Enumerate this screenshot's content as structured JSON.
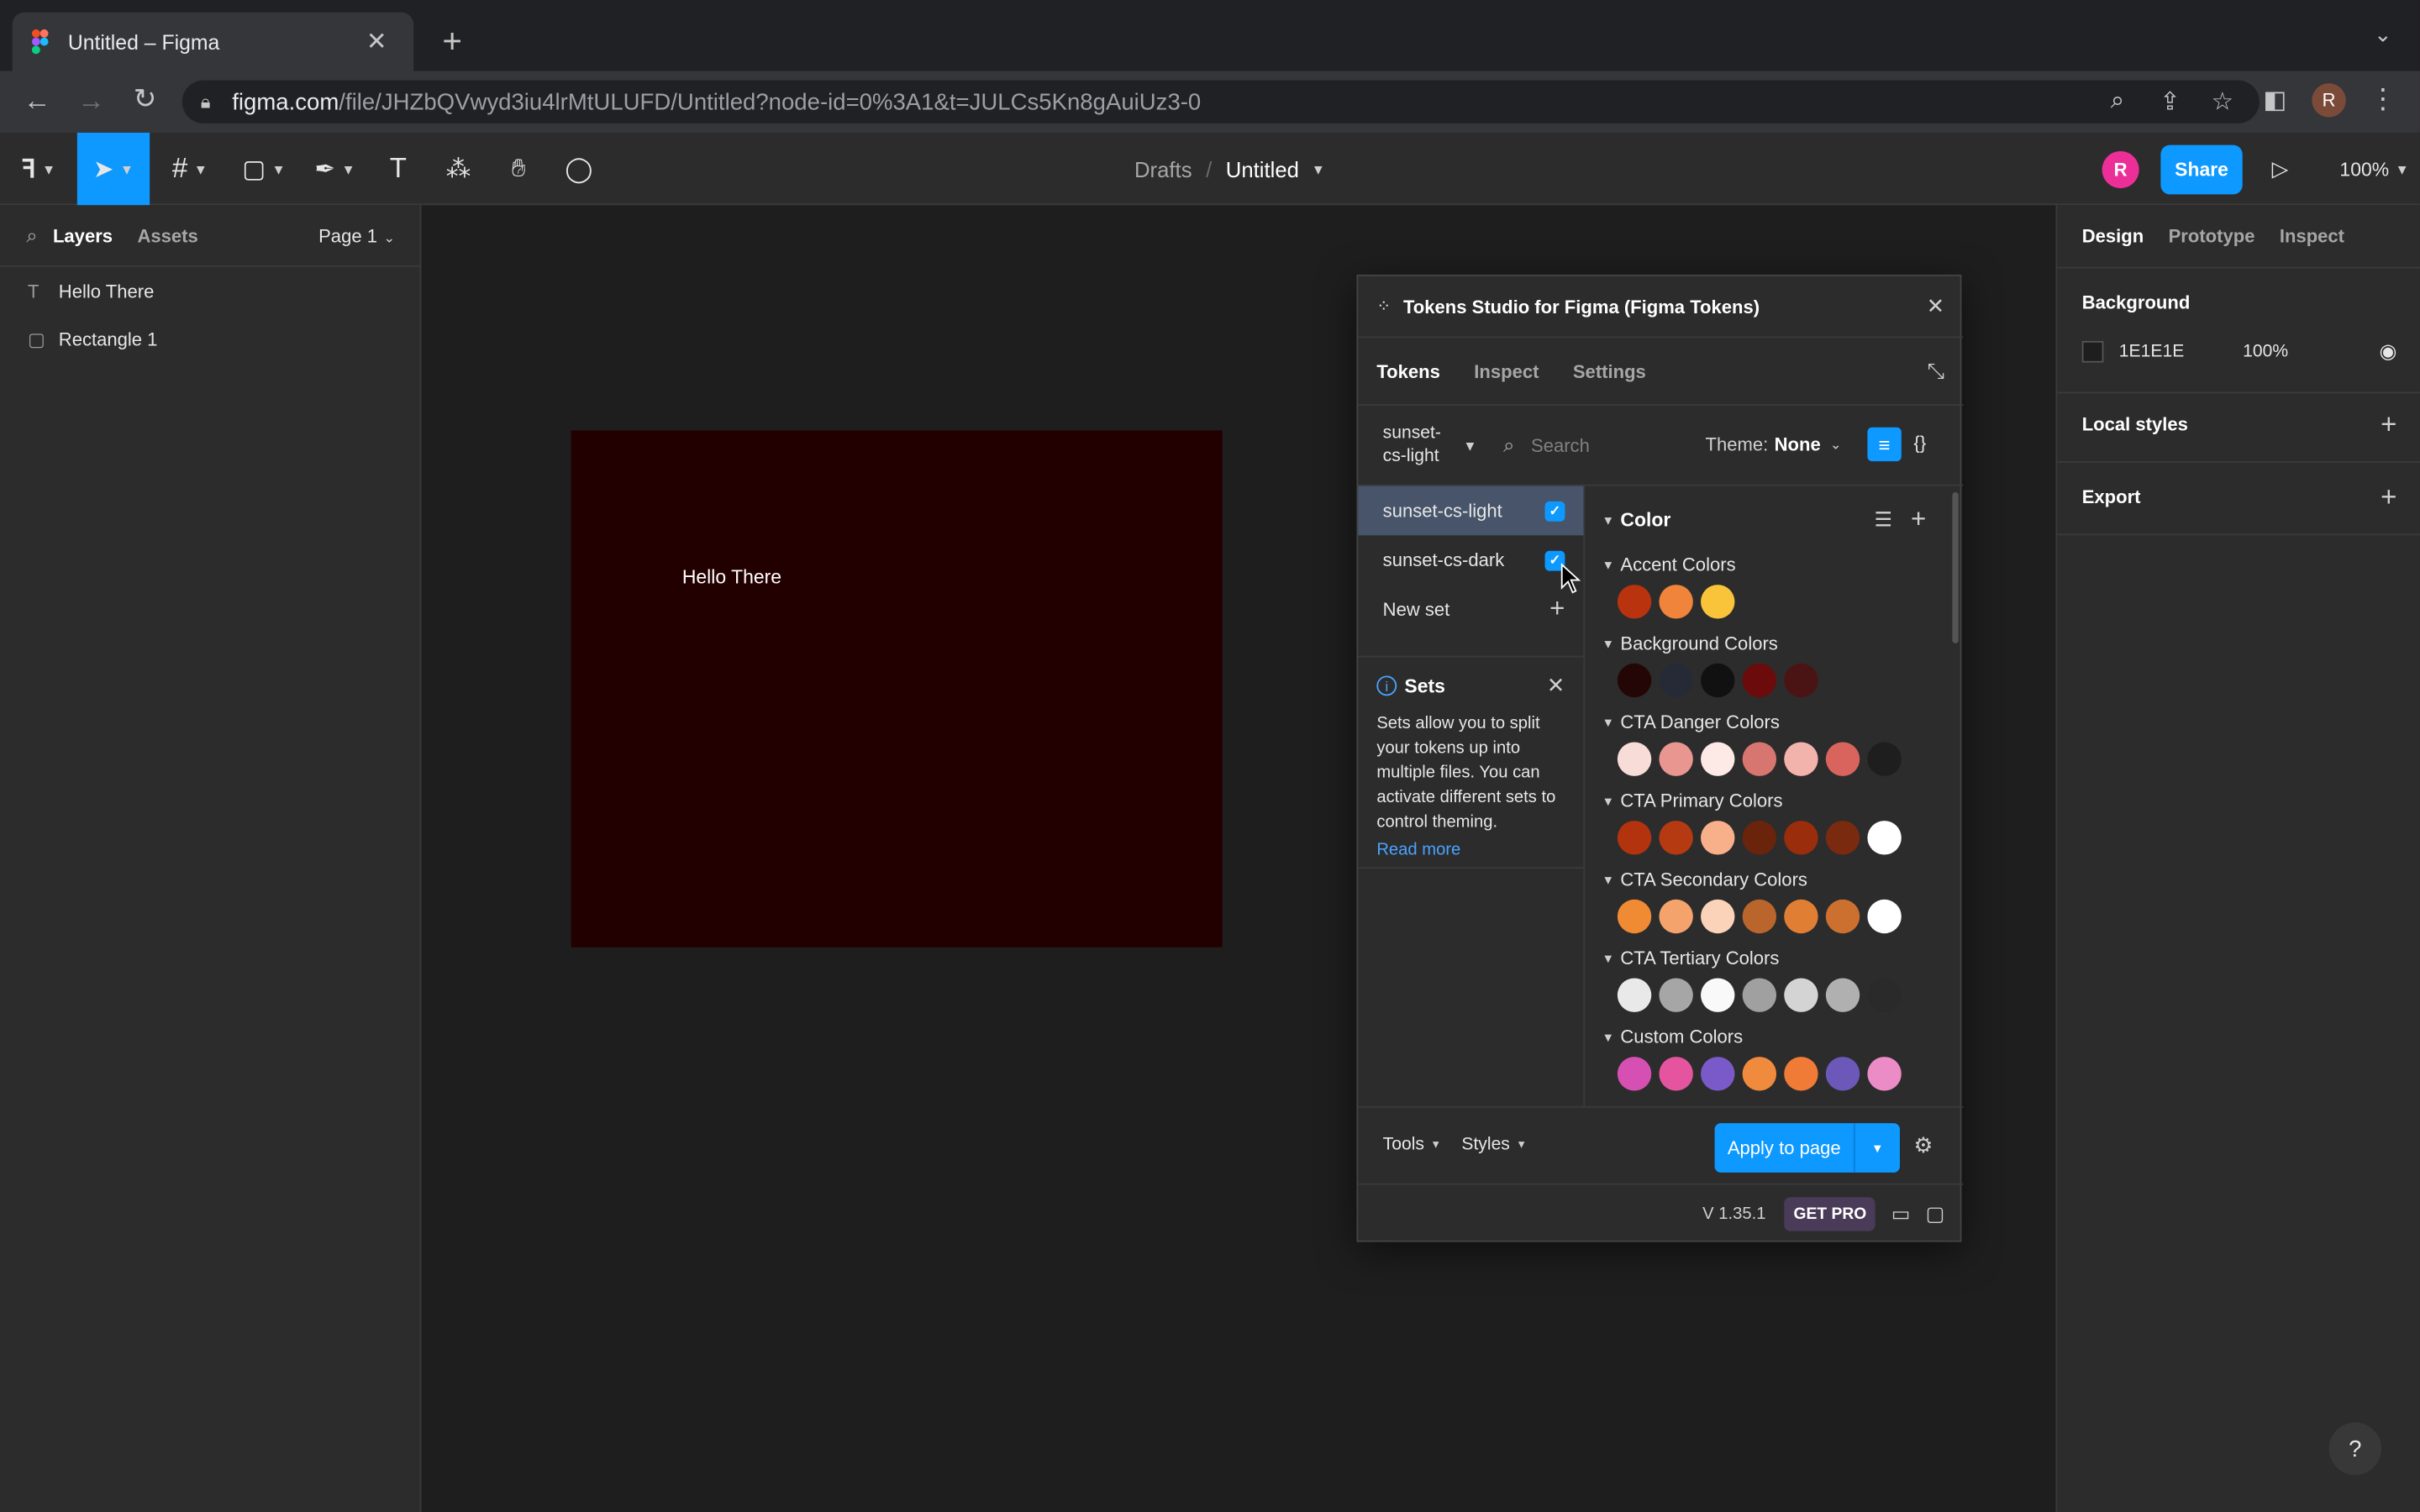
{
  "browser": {
    "tab_title": "Untitled – Figma",
    "url_domain": "figma.com",
    "url_path": "/file/JHZbQVwyd3iu4lrMtULUFD/Untitled?node-id=0%3A1&t=JULCs5Kn8gAuiUz3-0",
    "profile_initial": "R"
  },
  "toolbar": {
    "breadcrumb_root": "Drafts",
    "breadcrumb_sep": "/",
    "file_name": "Untitled",
    "avatar_initial": "R",
    "share_label": "Share",
    "zoom_label": "100%"
  },
  "left_panel": {
    "tab_layers": "Layers",
    "tab_assets": "Assets",
    "page_label": "Page 1",
    "layers": [
      {
        "name": "Hello There",
        "icon": "text-icon"
      },
      {
        "name": "Rectangle 1",
        "icon": "rectangle-icon"
      }
    ]
  },
  "canvas": {
    "frame_text": "Hello There",
    "frame_color": "#220000"
  },
  "right_panel": {
    "tab_design": "Design",
    "tab_prototype": "Prototype",
    "tab_inspect": "Inspect",
    "background_label": "Background",
    "background_hex": "1E1E1E",
    "background_opacity": "100%",
    "local_styles_label": "Local styles",
    "export_label": "Export"
  },
  "plugin": {
    "title": "Tokens Studio for Figma (Figma Tokens)",
    "tabs": [
      "Tokens",
      "Inspect",
      "Settings"
    ],
    "active_set_line1": "sunset-",
    "active_set_line2": "cs-light",
    "search_placeholder": "Search",
    "theme_label": "Theme:",
    "theme_value": "None",
    "sets": [
      {
        "name": "sunset-cs-light",
        "checked": true,
        "selected": true
      },
      {
        "name": "sunset-cs-dark",
        "checked": true,
        "selected": false
      }
    ],
    "new_set_label": "New set",
    "info_title": "Sets",
    "info_body": "Sets allow you to split your tokens up into multiple files. You can activate different sets to control theming.",
    "info_link": "Read more",
    "token_type": "Color",
    "groups": [
      {
        "title": "Accent Colors",
        "colors": [
          "#b8330e",
          "#f0843a",
          "#f9c43a"
        ]
      },
      {
        "title": "Background Colors",
        "colors": [
          "#240606",
          "#262a36",
          "#111111",
          "#6b0b0b",
          "#4b1414"
        ]
      },
      {
        "title": "CTA Danger Colors",
        "colors": [
          "#f8dcd8",
          "#e99590",
          "#fde9e6",
          "#d77570",
          "#f3b3ad",
          "#d9645e",
          "#1e1e1e"
        ]
      },
      {
        "title": "CTA Primary Colors",
        "colors": [
          "#b2330d",
          "#b63a11",
          "#f8b08a",
          "#6a240c",
          "#9a2d0c",
          "#7a2a0e",
          "#ffffff"
        ]
      },
      {
        "title": "CTA Secondary Colors",
        "colors": [
          "#f08a33",
          "#f5a36c",
          "#fbd3b8",
          "#b9652b",
          "#e07f33",
          "#cc7030",
          "#ffffff"
        ]
      },
      {
        "title": "CTA Tertiary Colors",
        "colors": [
          "#e9e9e9",
          "#a6a6a6",
          "#f9f9f9",
          "#a0a0a0",
          "#d4d4d4",
          "#b0b0b0",
          "#2a2a2a"
        ]
      },
      {
        "title": "Custom Colors",
        "colors": [
          "#d650b3",
          "#e5559f",
          "#7a5ac8",
          "#f08a3c",
          "#ef7b36",
          "#6c58b8",
          "#ec8cc6"
        ]
      }
    ],
    "tools_label": "Tools",
    "styles_label": "Styles",
    "apply_label": "Apply to page",
    "version": "V 1.35.1",
    "getpro_label": "GET PRO"
  },
  "help_label": "?"
}
